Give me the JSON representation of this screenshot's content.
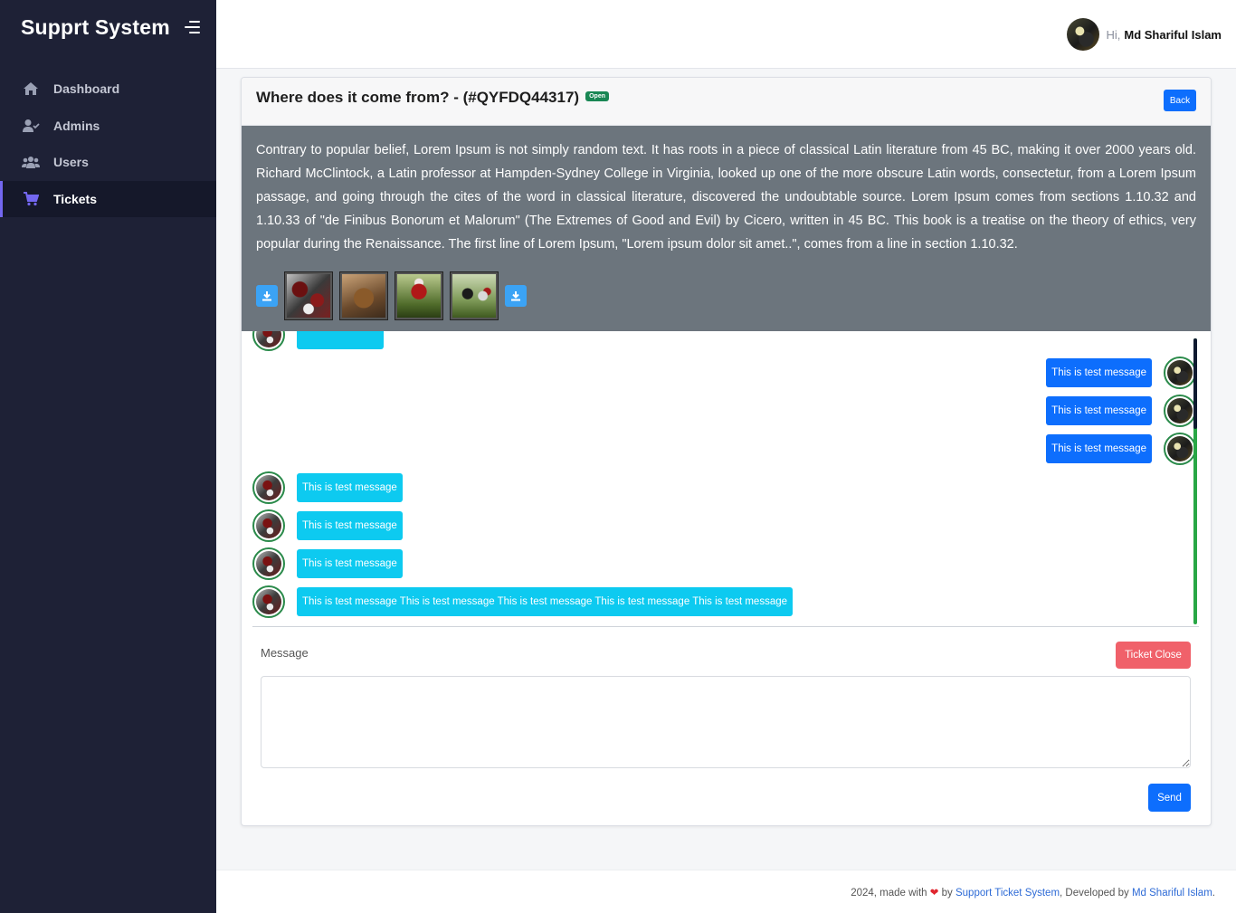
{
  "app": {
    "title": "Supprt System"
  },
  "sidebar": {
    "items": [
      {
        "label": "Dashboard",
        "icon": "home-icon"
      },
      {
        "label": "Admins",
        "icon": "user-check-icon"
      },
      {
        "label": "Users",
        "icon": "users-icon"
      },
      {
        "label": "Tickets",
        "icon": "cart-icon",
        "active": true
      }
    ]
  },
  "topbar": {
    "greeting": "Hi,",
    "user_name": "Md Shariful Islam"
  },
  "ticket": {
    "title": "Where does it come from? - (#QYFDQ44317)",
    "status": "Open",
    "back_label": "Back",
    "description": "Contrary to popular belief, Lorem Ipsum is not simply random text. It has roots in a piece of classical Latin literature from 45 BC, making it over 2000 years old. Richard McClintock, a Latin professor at Hampden-Sydney College in Virginia, looked up one of the more obscure Latin words, consectetur, from a Lorem Ipsum passage, and going through the cites of the word in classical literature, discovered the undoubtable source. Lorem Ipsum comes from sections 1.10.32 and 1.10.33 of \"de Finibus Bonorum et Malorum\" (The Extremes of Good and Evil) by Cicero, written in 45 BC. This book is a treatise on the theory of ethics, very popular during the Renaissance. The first line of Lorem Ipsum, \"Lorem ipsum dolor sit amet..\", comes from a line in section 1.10.32."
  },
  "messages": [
    {
      "side": "out",
      "text": "This is test message"
    },
    {
      "side": "out",
      "text": "This is test message"
    },
    {
      "side": "out",
      "text": "This is test message"
    },
    {
      "side": "in",
      "text": "This is test message"
    },
    {
      "side": "in",
      "text": "This is test message"
    },
    {
      "side": "in",
      "text": "This is test message"
    },
    {
      "side": "in",
      "text": "This is test message This is test message This is test message This is test message This is test message"
    }
  ],
  "reply": {
    "label": "Message",
    "close_label": "Ticket Close",
    "send_label": "Send",
    "textarea_value": ""
  },
  "footer": {
    "prefix": "2024, made with",
    "by": "by",
    "site_link": "Support Ticket System",
    "dev_text": ", Developed by",
    "dev_link": "Md Shariful Islam",
    "suffix": "."
  },
  "colors": {
    "sidebar_bg": "#1e2136",
    "primary": "#0d6efd",
    "info": "#0dcaf0",
    "danger": "#f0616a",
    "success": "#198754"
  }
}
